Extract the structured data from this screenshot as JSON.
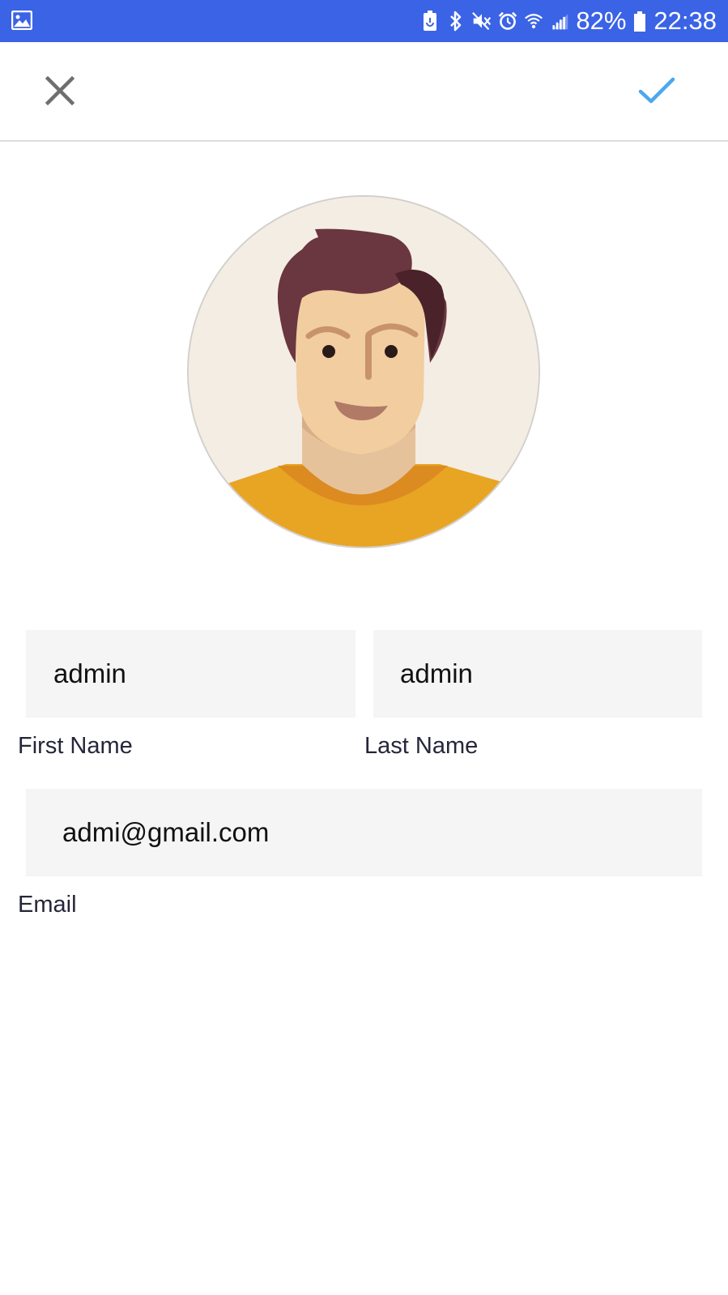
{
  "status_bar": {
    "battery_percent": "82%",
    "time": "22:38",
    "background_color": "#3b63e6",
    "icons": [
      "gallery-icon",
      "battery-saver-icon",
      "bluetooth-icon",
      "mute-icon",
      "alarm-icon",
      "wifi-icon",
      "signal-icon",
      "battery-icon"
    ]
  },
  "toolbar": {
    "close_icon": "close-icon",
    "confirm_icon": "check-icon",
    "confirm_color": "#4aa8f0"
  },
  "profile": {
    "avatar_icon": "user-avatar-illustration"
  },
  "form": {
    "first_name": {
      "value": "admin",
      "label": "First Name"
    },
    "last_name": {
      "value": "admin",
      "label": "Last Name"
    },
    "email": {
      "value": "admi@gmail.com",
      "label": "Email"
    }
  }
}
